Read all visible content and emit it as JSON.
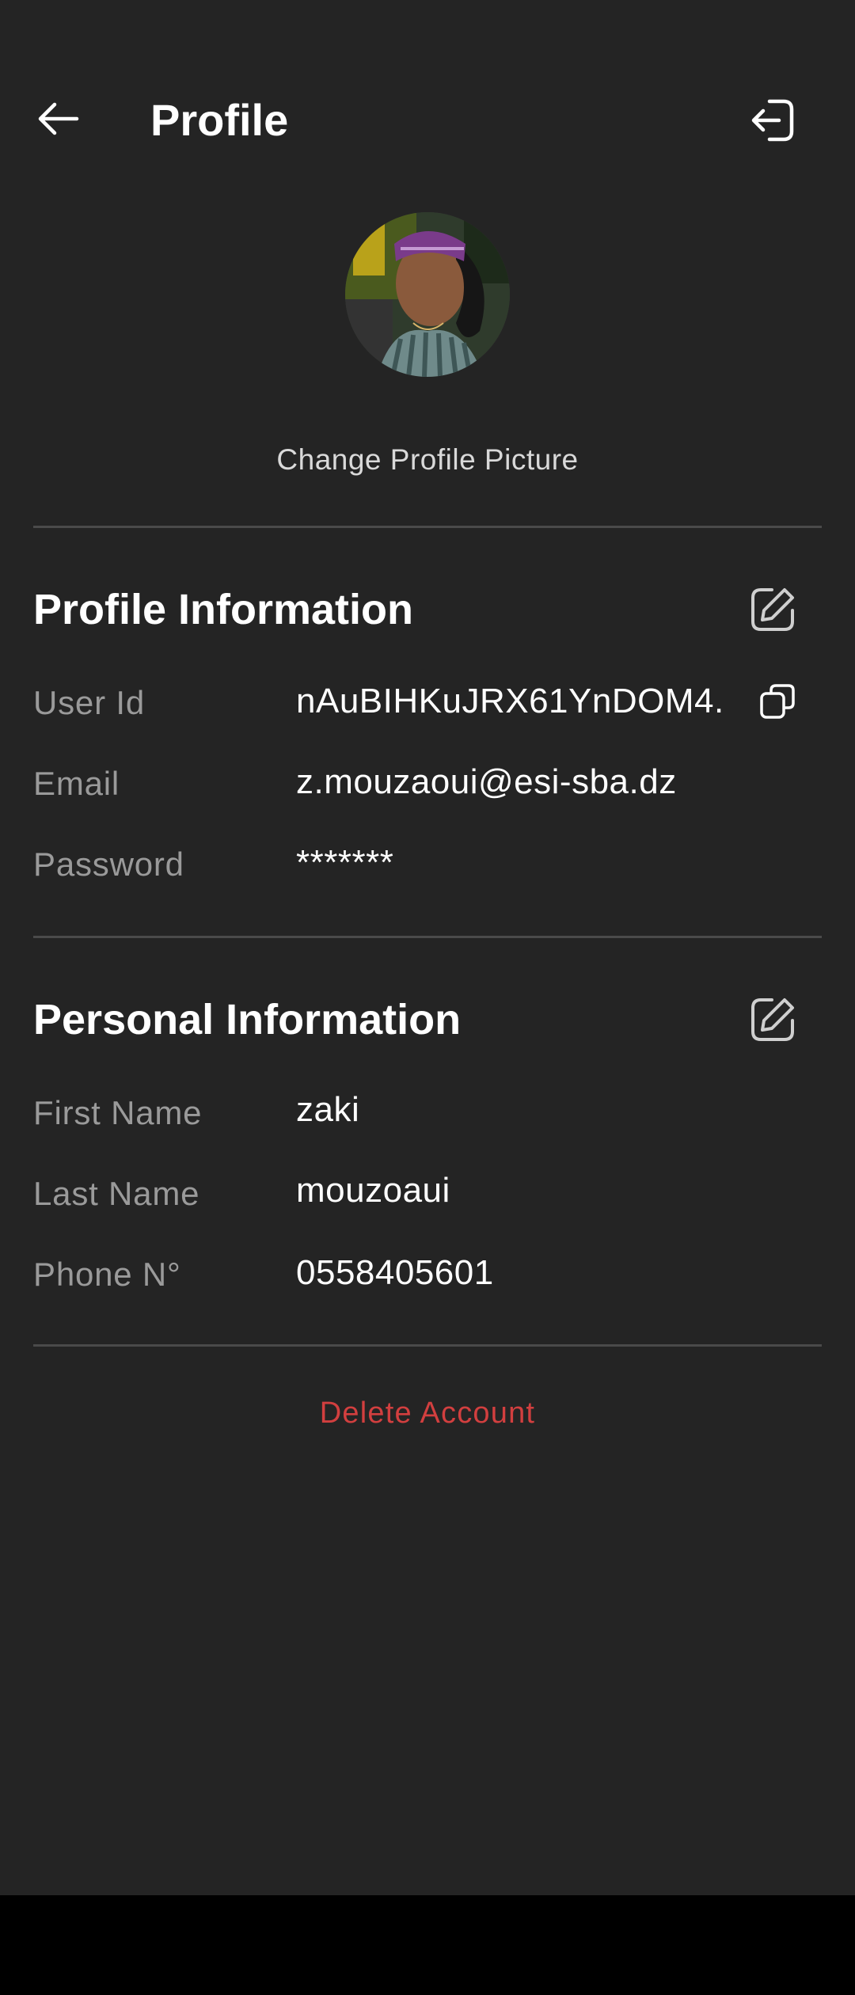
{
  "header": {
    "title": "Profile",
    "back_icon": "arrow-left-icon",
    "logout_icon": "logout-icon"
  },
  "avatar": {
    "change_label": "Change Profile Picture"
  },
  "profile_info": {
    "title": "Profile Information",
    "edit_icon": "edit-icon",
    "rows": [
      {
        "label": "User Id",
        "value": "nAuBIHKuJRX61YnDOM4..."
      },
      {
        "label": "Email",
        "value": "z.mouzaoui@esi-sba.dz"
      },
      {
        "label": "Password",
        "value": "*******"
      }
    ],
    "copy_icon": "copy-icon"
  },
  "personal_info": {
    "title": "Personal Information",
    "edit_icon": "edit-icon",
    "rows": [
      {
        "label": "First Name",
        "value": "zaki"
      },
      {
        "label": "Last Name",
        "value": "mouzoaui"
      },
      {
        "label": "Phone N°",
        "value": "0558405601"
      }
    ]
  },
  "actions": {
    "delete_label": "Delete Account"
  },
  "colors": {
    "background": "#242424",
    "label": "#9a9a9a",
    "danger": "#d23f3f",
    "divider": "#4a4a4a"
  }
}
